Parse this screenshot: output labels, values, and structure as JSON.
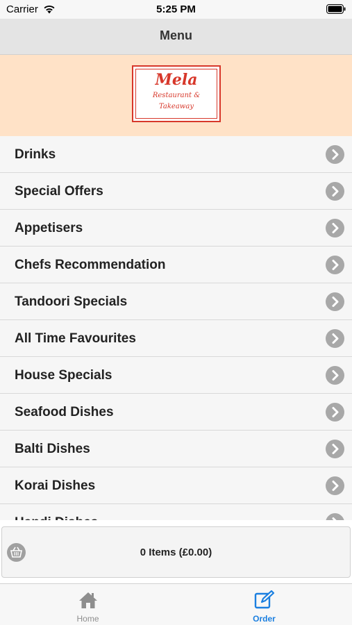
{
  "status_bar": {
    "carrier": "Carrier",
    "time": "5:25 PM"
  },
  "nav": {
    "title": "Menu"
  },
  "banner": {
    "logo_name": "Mela",
    "logo_line1": "Restaurant &",
    "logo_line2": "Takeaway"
  },
  "menu": {
    "items": [
      {
        "label": "Drinks"
      },
      {
        "label": "Special Offers"
      },
      {
        "label": "Appetisers"
      },
      {
        "label": "Chefs Recommendation"
      },
      {
        "label": "Tandoori Specials"
      },
      {
        "label": "All Time Favourites"
      },
      {
        "label": "House Specials"
      },
      {
        "label": "Seafood Dishes"
      },
      {
        "label": "Balti Dishes"
      },
      {
        "label": "Korai Dishes"
      },
      {
        "label": "Handi Dishes"
      }
    ]
  },
  "order_bar": {
    "summary": "0 Items (£0.00)",
    "icon": "basket-icon"
  },
  "tabs": [
    {
      "label": "Home",
      "icon": "home-icon",
      "active": false
    },
    {
      "label": "Order",
      "icon": "edit-icon",
      "active": true
    }
  ],
  "colors": {
    "accent": "#1b7fe0",
    "banner": "#ffe2c7",
    "logo": "#d7372a",
    "chevron": "#a8a8a8"
  }
}
